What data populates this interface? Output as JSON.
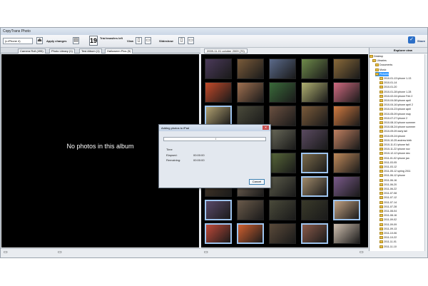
{
  "window": {
    "title": "CopyTrans Photo"
  },
  "toolbar": {
    "device": "(c.iPhone 4)",
    "apply_changes": "Apply changes",
    "trial_count": "19",
    "trial_label": "Trial transfers left",
    "view_label": "View",
    "slideshow_label": "Slideshow",
    "share_label": "Share"
  },
  "left": {
    "tabs": [
      "Camera Roll (495)",
      "Photo Library (1)",
      "Test Album (1)",
      "Halloween Pics (5)"
    ],
    "active_tab": 3,
    "empty_message": "No photos in this album"
  },
  "middle": {
    "tab": "2009-11-01 october 2009 (70)"
  },
  "explorer": {
    "title": "Explorer view",
    "nodes": [
      "Desktop",
      "Libraries",
      "Documents",
      "Music",
      "Pictures",
      "2010-01-13 iphone 1-13",
      "2010-01-14",
      "2010-01-20",
      "2010-01-28 iphone 1-28",
      "2010-02-04 iphone Feb 2",
      "2010-04-08 iphone april",
      "2010-04-16 iphone april 2",
      "2010-04-23 iphone april",
      "2010-05-09 iphone may",
      "2010-07-27 iphone 2",
      "2010-08-10 iphone summer",
      "2010-08-24 iphone summer",
      "2010-09-09 early fall",
      "2010-09-24 iphone",
      "2010-10-25 andrew birth",
      "2010-11-01 iphone fall",
      "2010-11-22 iphone nov",
      "2010-12-12 iphone dec",
      "2011-01-02 iphone jan",
      "2011-03-05",
      "2011-03-12",
      "2011-05-12 spring 2011",
      "2011-06-12 iphone",
      "2011-06-16",
      "2011-06-20",
      "2011-06-22",
      "2011-07-08",
      "2011-07-12",
      "2011-07-14",
      "2011-07-28",
      "2011-08-04",
      "2011-08-16",
      "2011-09-02",
      "2011-09-09",
      "2011-09-13",
      "2011-10-06",
      "2011-10-22",
      "2011-11-01",
      "2011-11-10"
    ]
  },
  "dialog": {
    "title": "Adding photos to iPad",
    "progress_text": "/",
    "time_header": "Time",
    "elapsed_label": "Elapsed:",
    "elapsed_value": "00:00:00",
    "remaining_label": "Remaining:",
    "remaining_value": "00:00:00",
    "cancel": "Cancel"
  },
  "colors": {
    "photo_bg": "#000000",
    "selection": "#9ec4ee",
    "accent": "#2c6fc7",
    "folder": "#e8c14a"
  },
  "thumbnails": [
    {
      "c": "#4b3a5a",
      "sel": false
    },
    {
      "c": "#7a5b3a",
      "sel": false
    },
    {
      "c": "#5b6a8a",
      "sel": false
    },
    {
      "c": "#6e8a4a",
      "sel": false
    },
    {
      "c": "#8a6a3a",
      "sel": false
    },
    {
      "c": "#c44a2a",
      "sel": false
    },
    {
      "c": "#a07050",
      "sel": false
    },
    {
      "c": "#3a6a3a",
      "sel": false
    },
    {
      "c": "#b0b070",
      "sel": false
    },
    {
      "c": "#d06a80",
      "sel": false
    },
    {
      "c": "#b0a070",
      "sel": true
    },
    {
      "c": "#4a4a3a",
      "sel": false
    },
    {
      "c": "#6a5040",
      "sel": false
    },
    {
      "c": "#7a5a3a",
      "sel": false
    },
    {
      "c": "#d07a40",
      "sel": false
    },
    {
      "c": "#303a5a",
      "sel": false
    },
    {
      "c": "#5a4a3a",
      "sel": false
    },
    {
      "c": "#6a6a5a",
      "sel": false
    },
    {
      "c": "#5a4a60",
      "sel": false
    },
    {
      "c": "#c08060",
      "sel": false
    },
    {
      "c": "#6a5a4a",
      "sel": false
    },
    {
      "c": "#4a7a8a",
      "sel": false
    },
    {
      "c": "#5a6a3a",
      "sel": false
    },
    {
      "c": "#7a6a4a",
      "sel": true
    },
    {
      "c": "#c08a5a",
      "sel": false
    },
    {
      "c": "#4a3a2a",
      "sel": false
    },
    {
      "c": "#7a6a5a",
      "sel": false
    },
    {
      "c": "#5a5a4a",
      "sel": false
    },
    {
      "c": "#a08a6a",
      "sel": true
    },
    {
      "c": "#7a5a8a",
      "sel": false
    },
    {
      "c": "#5a4a6a",
      "sel": true
    },
    {
      "c": "#6a5a4a",
      "sel": false
    },
    {
      "c": "#4a4a3a",
      "sel": false
    },
    {
      "c": "#3a3a2a",
      "sel": false
    },
    {
      "c": "#c0a080",
      "sel": true
    },
    {
      "c": "#c04a3a",
      "sel": true
    },
    {
      "c": "#d06030",
      "sel": true
    },
    {
      "c": "#5a4a3a",
      "sel": false
    },
    {
      "c": "#8a5a4a",
      "sel": true
    },
    {
      "c": "#d0c0b0",
      "sel": false
    }
  ]
}
